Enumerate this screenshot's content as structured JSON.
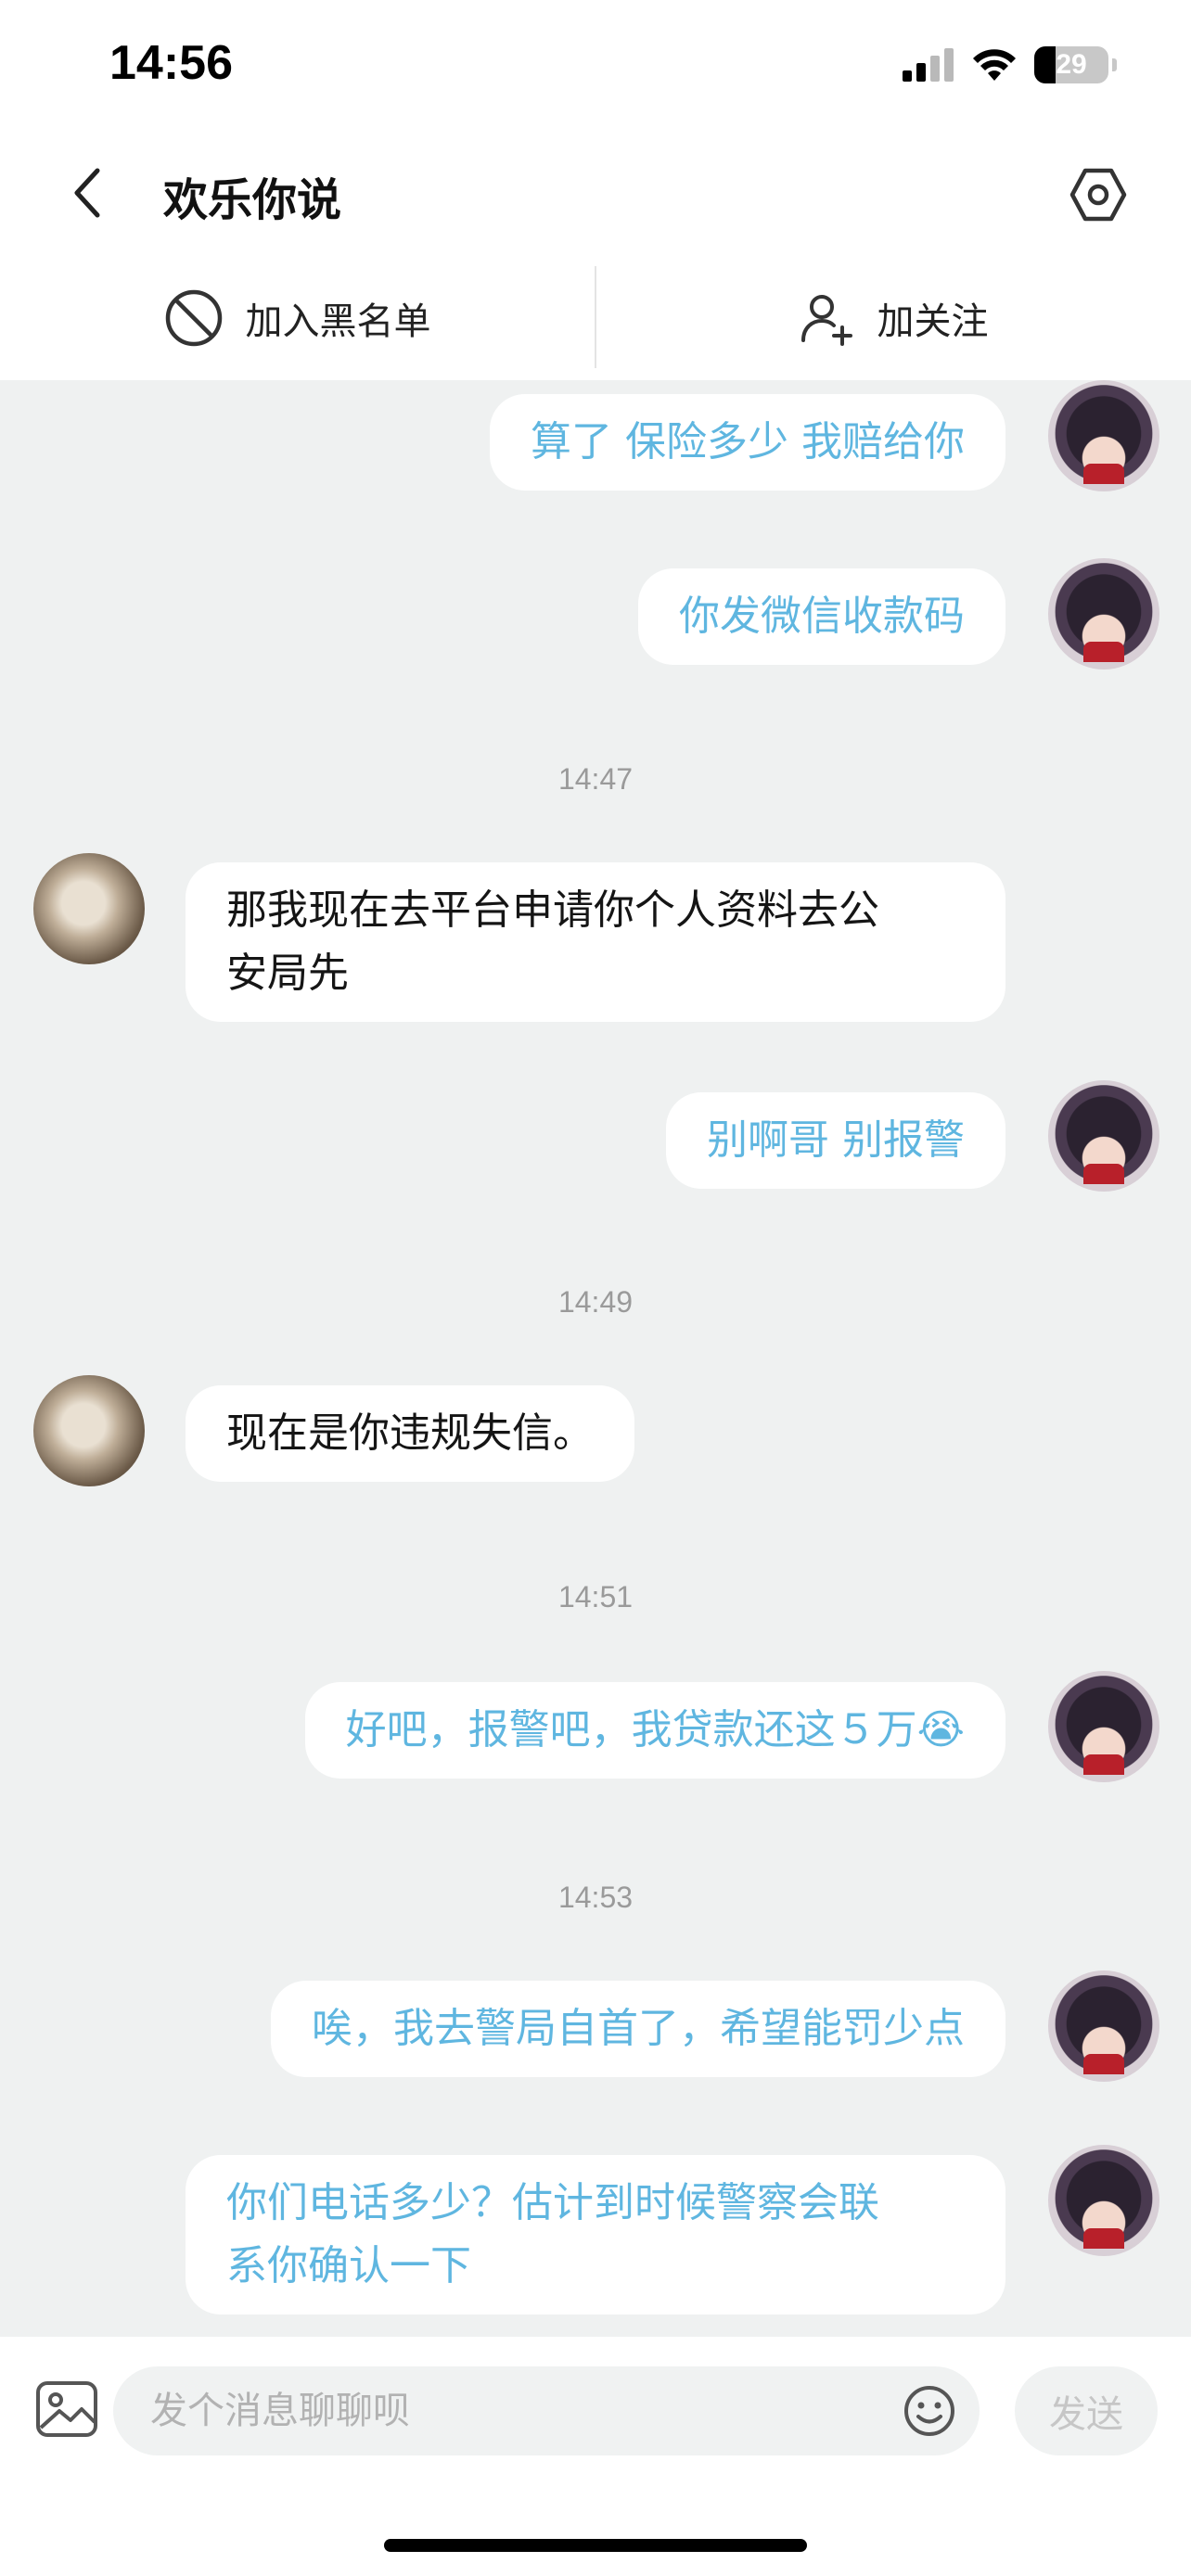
{
  "status_bar": {
    "time": "14:56",
    "battery_level": "29",
    "battery_fraction": 0.29,
    "icons": [
      "cellular-signal-icon",
      "wifi-icon",
      "battery-icon"
    ]
  },
  "nav": {
    "title": "欢乐你说",
    "back_icon": "chevron-left-icon",
    "settings_icon": "hexagon-settings-icon"
  },
  "actions": {
    "blacklist_label": "加入黑名单",
    "follow_label": "加关注"
  },
  "colors": {
    "self_text": "#5fb6e0",
    "other_text": "#151515",
    "chat_background": "#eff1f1",
    "timestamp": "#9a9a9a"
  },
  "messages": [
    {
      "sender": "self",
      "text": "算了 保险多少 我赔给你"
    },
    {
      "sender": "self",
      "text": "你发微信收款码"
    },
    {
      "type": "time",
      "text": "14:47"
    },
    {
      "sender": "other",
      "line1": "那我现在去平台申请你个人资料去公",
      "line2": "安局先"
    },
    {
      "sender": "self",
      "text": "别啊哥 别报警"
    },
    {
      "type": "time",
      "text": "14:49"
    },
    {
      "sender": "other",
      "text": "现在是你违规失信。"
    },
    {
      "type": "time",
      "text": "14:51"
    },
    {
      "sender": "self",
      "text": "好吧，报警吧，我贷款还这５万",
      "emoji": "😭"
    },
    {
      "type": "time",
      "text": "14:53"
    },
    {
      "sender": "self",
      "text": "唉，我去警局自首了，希望能罚少点"
    },
    {
      "sender": "self",
      "line1": "你们电话多少？估计到时候警察会联",
      "line2": "系你确认一下"
    }
  ],
  "input": {
    "placeholder": "发个消息聊聊呗",
    "send_label": "发送",
    "image_icon": "image-icon",
    "emoji_icon": "smiley-icon"
  }
}
